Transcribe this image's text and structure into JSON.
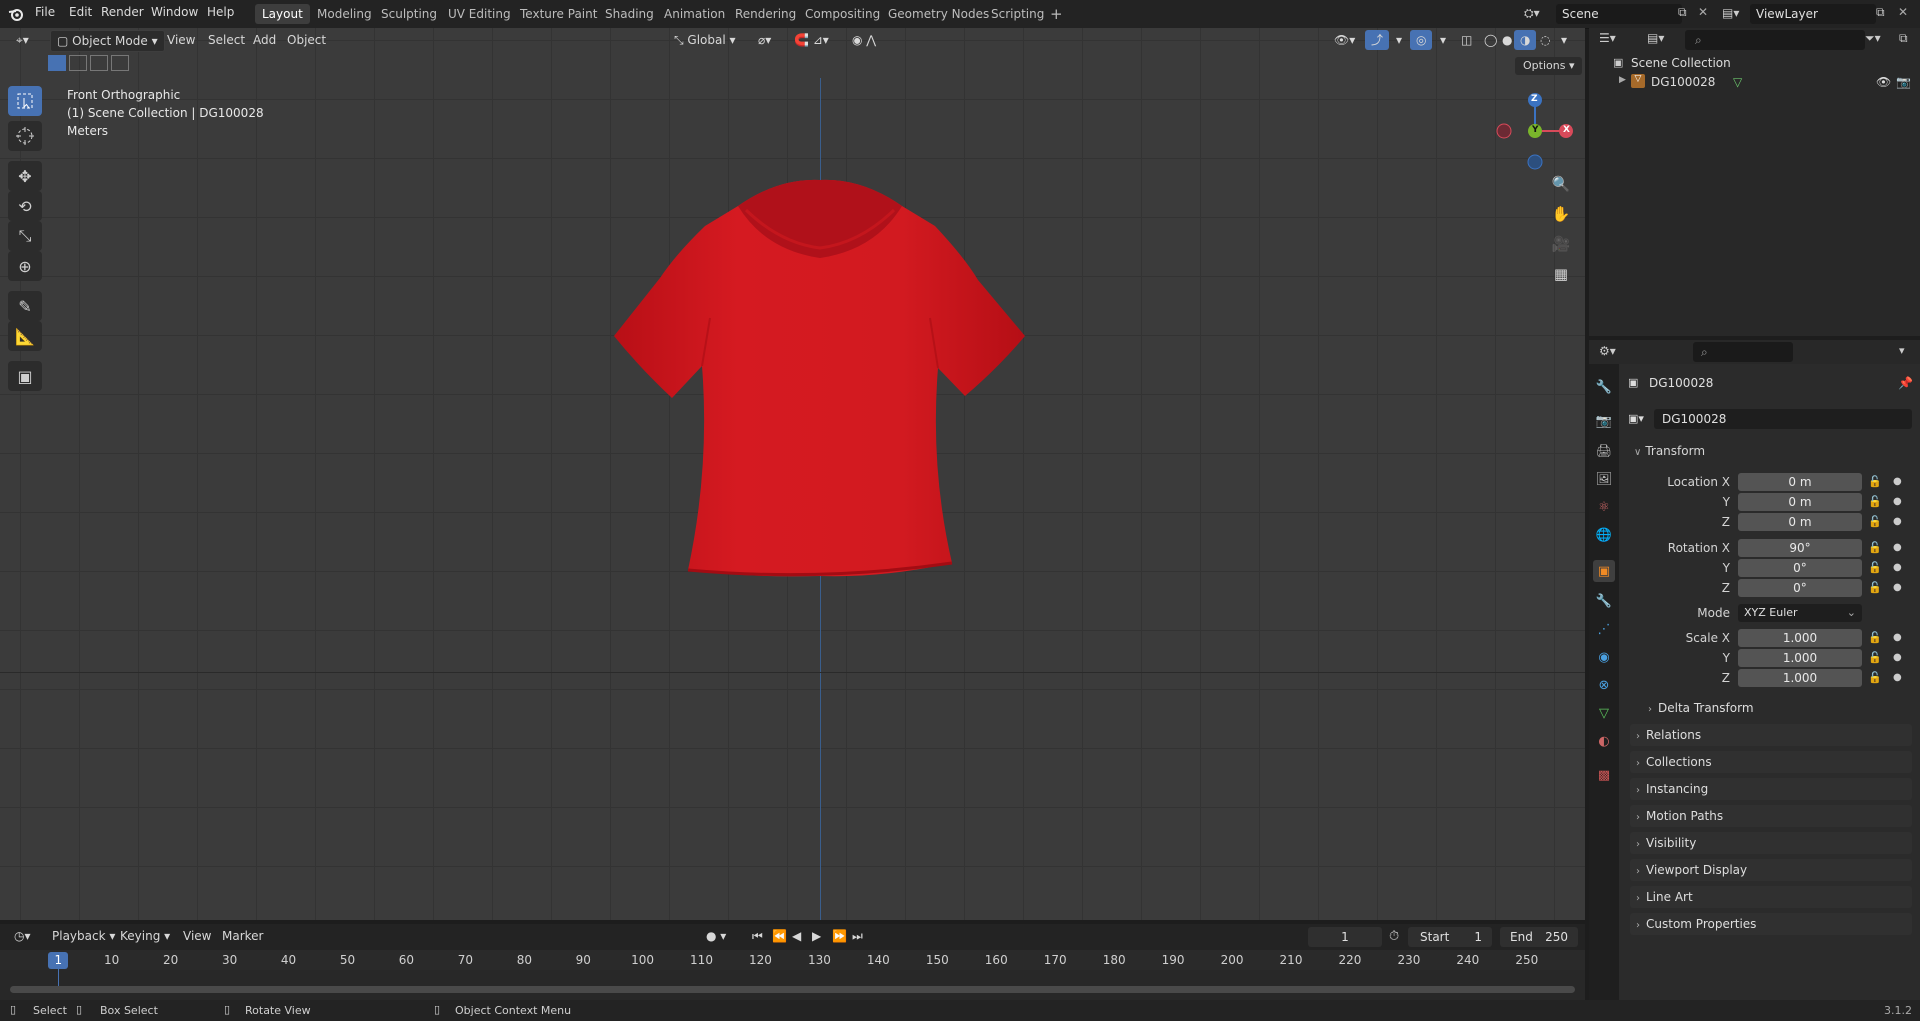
{
  "menus": [
    "File",
    "Edit",
    "Render",
    "Window",
    "Help"
  ],
  "workspaces": [
    "Layout",
    "Modeling",
    "Sculpting",
    "UV Editing",
    "Texture Paint",
    "Shading",
    "Animation",
    "Rendering",
    "Compositing",
    "Geometry Nodes",
    "Scripting"
  ],
  "active_workspace": "Layout",
  "scene_name": "Scene",
  "view_layer": "ViewLayer",
  "viewport": {
    "mode": "Object Mode",
    "menu": [
      "View",
      "Select",
      "Add",
      "Object"
    ],
    "orientation": "Global",
    "options_label": "Options",
    "info_view": "Front Orthographic",
    "info_collection": "(1) Scene Collection | DG100028",
    "info_units": "Meters",
    "gizmo": {
      "z": "Z",
      "y": "Y",
      "x": "X"
    },
    "object_color": "#d2141c"
  },
  "outliner": {
    "root": "Scene Collection",
    "items": [
      {
        "name": "DG100028"
      }
    ]
  },
  "properties": {
    "object_name": "DG100028",
    "data_name": "DG100028",
    "transform_title": "Transform",
    "location": {
      "label_x": "Location X",
      "label_y": "Y",
      "label_z": "Z",
      "x": "0 m",
      "y": "0 m",
      "z": "0 m"
    },
    "rotation": {
      "label_x": "Rotation X",
      "label_y": "Y",
      "label_z": "Z",
      "x": "90°",
      "y": "0°",
      "z": "0°"
    },
    "mode_label": "Mode",
    "mode_value": "XYZ Euler",
    "scale": {
      "label_x": "Scale X",
      "label_y": "Y",
      "label_z": "Z",
      "x": "1.000",
      "y": "1.000",
      "z": "1.000"
    },
    "delta_transform": "Delta Transform",
    "panels": [
      "Relations",
      "Collections",
      "Instancing",
      "Motion Paths",
      "Visibility",
      "Viewport Display",
      "Line Art",
      "Custom Properties"
    ]
  },
  "timeline": {
    "menu": [
      "Playback",
      "Keying",
      "View",
      "Marker"
    ],
    "current_frame": "1",
    "start_label": "Start",
    "start": "1",
    "end_label": "End",
    "end": "250",
    "ticks": [
      "1",
      "10",
      "20",
      "30",
      "40",
      "50",
      "60",
      "70",
      "80",
      "90",
      "100",
      "110",
      "120",
      "130",
      "140",
      "150",
      "160",
      "170",
      "180",
      "190",
      "200",
      "210",
      "220",
      "230",
      "240",
      "250"
    ]
  },
  "statusbar": {
    "select": "Select",
    "box_select": "Box Select",
    "rotate_view": "Rotate View",
    "context_menu": "Object Context Menu",
    "version": "3.1.2"
  }
}
